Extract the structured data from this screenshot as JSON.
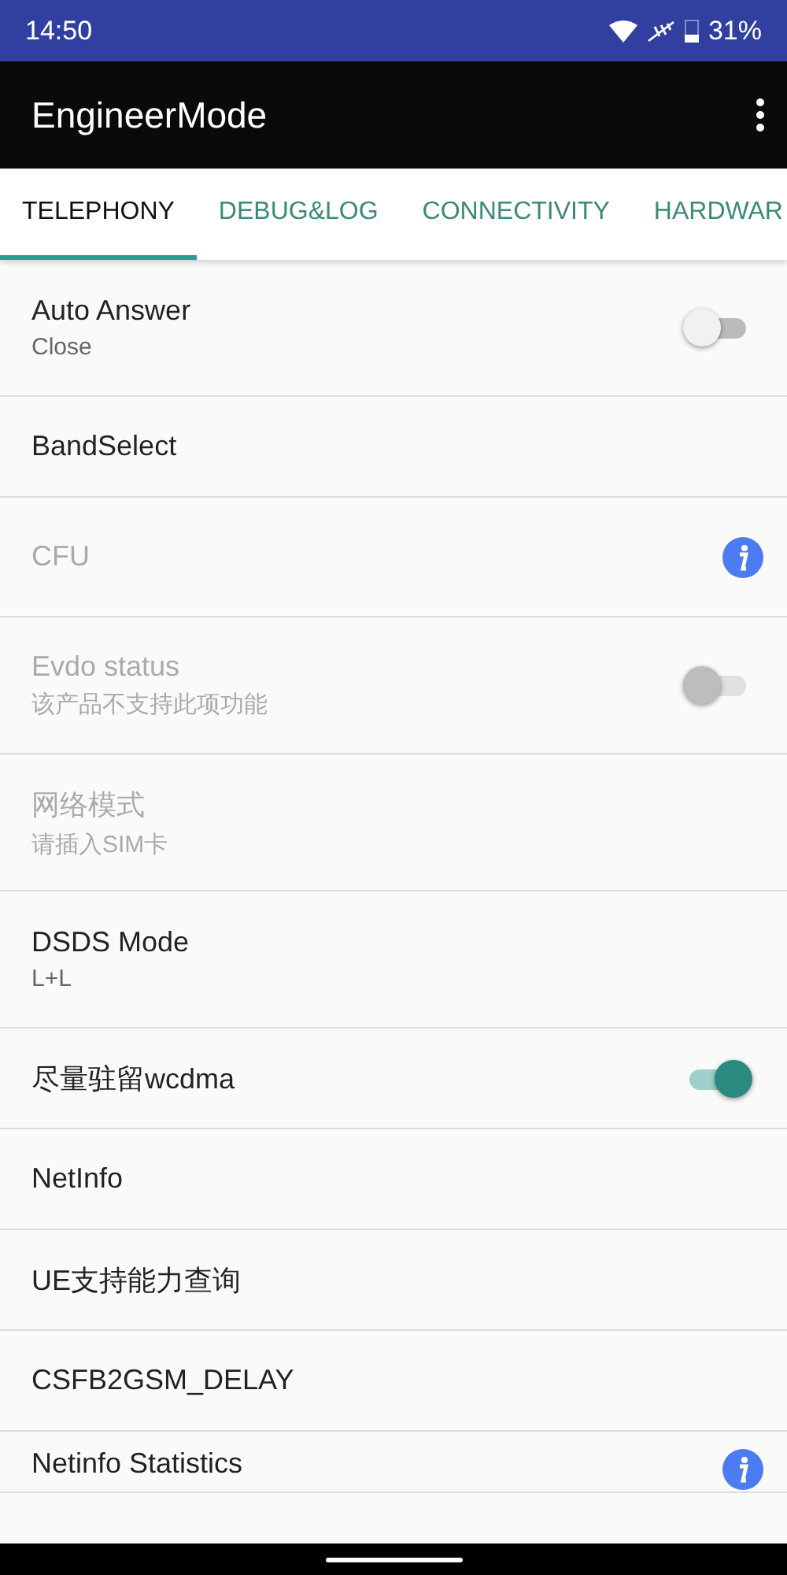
{
  "status_bar": {
    "time": "14:50",
    "battery": "31%"
  },
  "app_bar": {
    "title": "EngineerMode"
  },
  "tabs": [
    {
      "label": "TELEPHONY",
      "selected": true
    },
    {
      "label": "DEBUG&LOG",
      "selected": false
    },
    {
      "label": "CONNECTIVITY",
      "selected": false
    },
    {
      "label": "HARDWAR",
      "selected": false
    }
  ],
  "items": [
    {
      "kind": "switch",
      "title": "Auto Answer",
      "subtitle": "Close",
      "disabled": false,
      "on": false
    },
    {
      "kind": "plain",
      "title": "BandSelect",
      "disabled": false
    },
    {
      "kind": "info",
      "title": "CFU",
      "disabled": true
    },
    {
      "kind": "switch",
      "title": "Evdo status",
      "subtitle": "该产品不支持此项功能",
      "disabled": true,
      "on": false
    },
    {
      "kind": "plain",
      "title": "网络模式",
      "subtitle": "请插入SIM卡",
      "disabled": true
    },
    {
      "kind": "plain",
      "title": "DSDS Mode",
      "subtitle": "L+L",
      "disabled": false
    },
    {
      "kind": "switch",
      "title": "尽量驻留wcdma",
      "disabled": false,
      "on": true
    },
    {
      "kind": "plain",
      "title": "NetInfo",
      "disabled": false
    },
    {
      "kind": "plain",
      "title": "UE支持能力查询",
      "disabled": false
    },
    {
      "kind": "plain",
      "title": "CSFB2GSM_DELAY",
      "disabled": false
    },
    {
      "kind": "info",
      "title": "Netinfo Statistics",
      "disabled": false
    }
  ]
}
